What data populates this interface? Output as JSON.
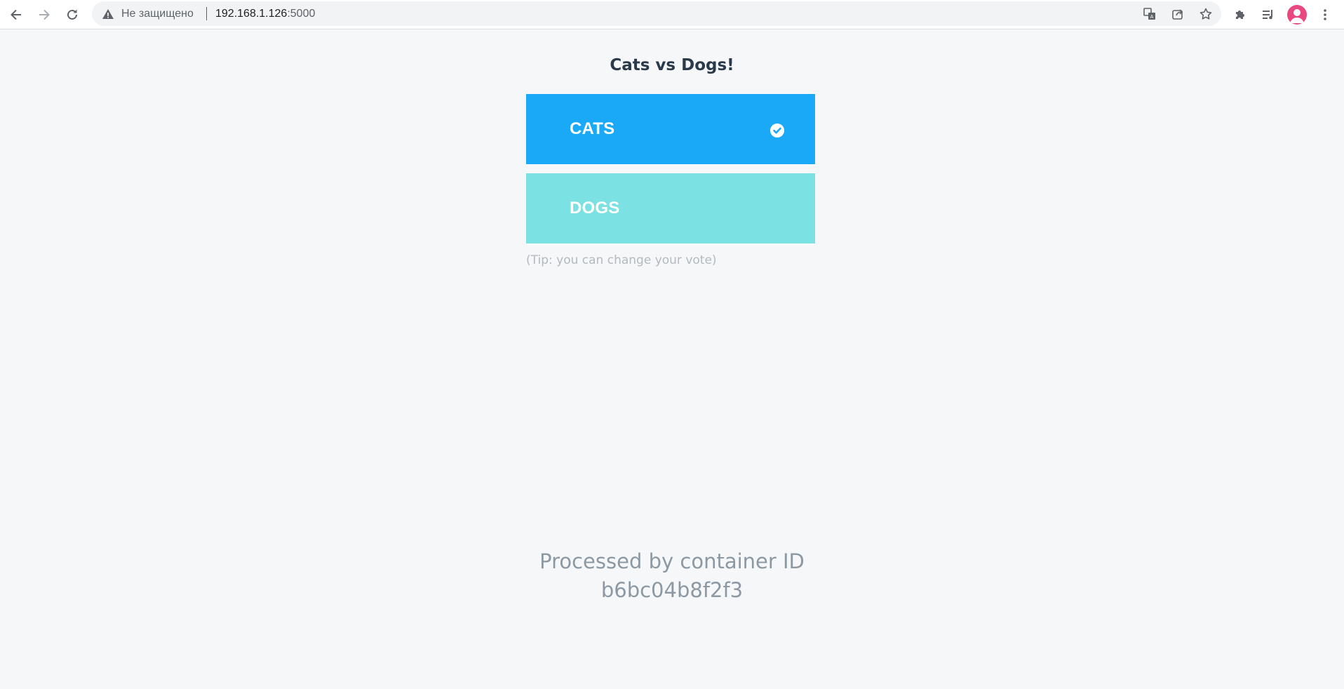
{
  "browser": {
    "security_status": "Не защищено",
    "url_host": "192.168.1.126",
    "url_port": ":5000",
    "icons": {
      "back": "back-arrow-icon",
      "forward": "forward-arrow-icon",
      "reload": "reload-icon",
      "warning": "warning-icon",
      "translate": "translate-icon",
      "share": "share-icon",
      "bookmark": "star-icon",
      "extensions": "puzzle-icon",
      "media": "media-queue-icon",
      "profile": "avatar",
      "menu": "kebab-menu-icon"
    },
    "avatar_color": "#e8477f"
  },
  "page": {
    "title": "Cats vs Dogs!",
    "options": [
      {
        "label": "CATS",
        "selected": true,
        "color": "#1aa9f7"
      },
      {
        "label": "DOGS",
        "selected": false,
        "color": "#7ce1e2"
      }
    ],
    "tip": "(Tip: you can change your vote)",
    "processed_label": "Processed by container ID",
    "container_id": "b6bc04b8f2f3"
  }
}
